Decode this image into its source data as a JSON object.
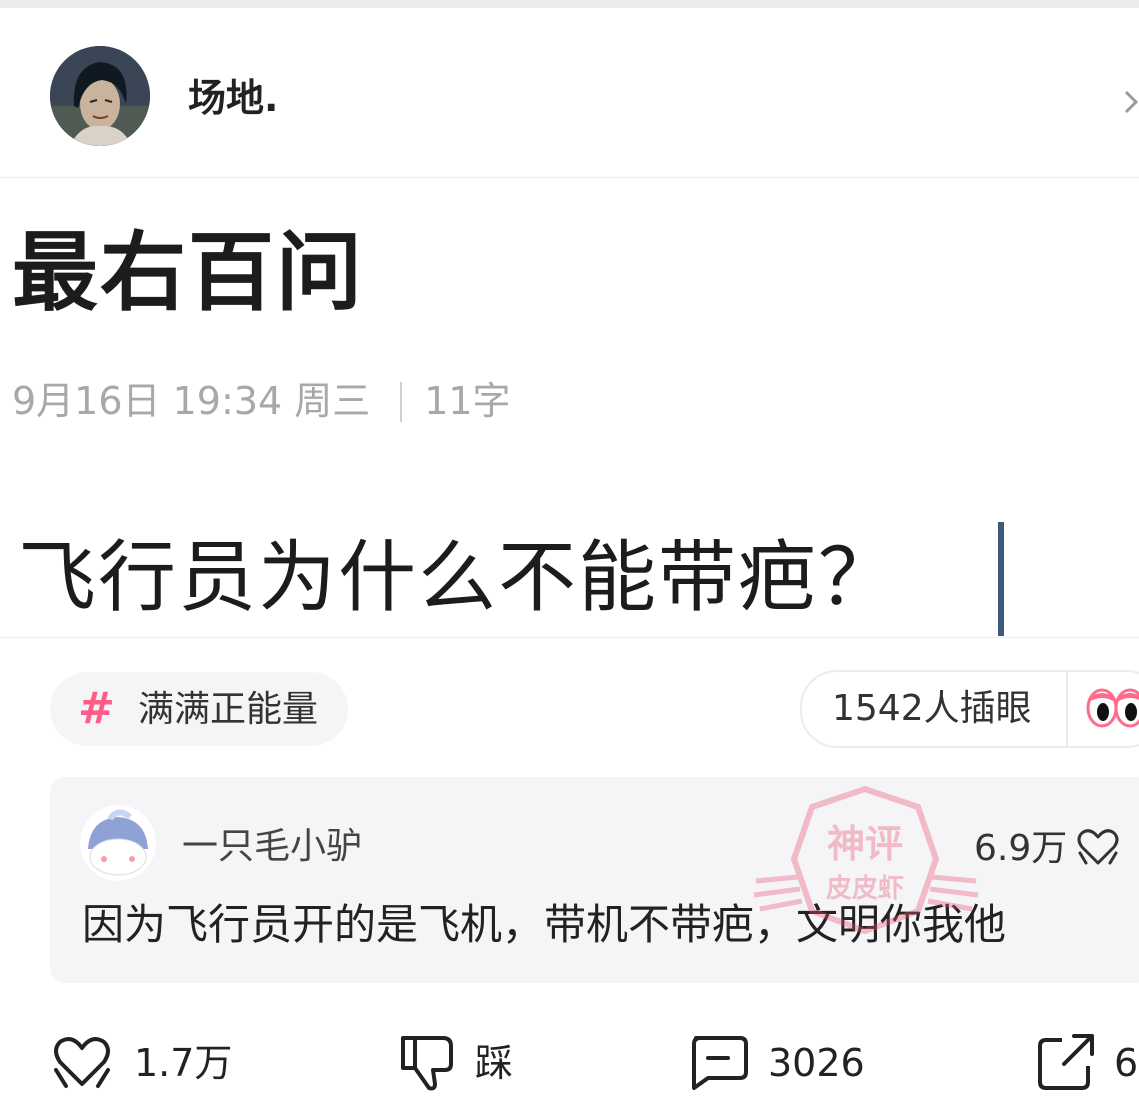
{
  "header": {
    "username": "场地."
  },
  "note": {
    "title": "最右百问",
    "date": "9月16日 19:34 周三",
    "word_count": "11字",
    "body": "飞行员为什么不能带疤？"
  },
  "tags": {
    "topic": "满满正能量",
    "topic_symbol": "#",
    "poke_label": "1542人插眼"
  },
  "comment": {
    "author": "一只毛小驴",
    "likes": "6.9万",
    "text": "因为飞行员开的是飞机，带机不带疤，文明你我他"
  },
  "watermark": {
    "line1": "神评",
    "line2": "皮皮虾"
  },
  "actions": {
    "like_count": "1.7万",
    "dislike_label": "踩",
    "comment_count": "3026",
    "share_count": "6"
  },
  "colors": {
    "accent_pink": "#ff5d86",
    "caret": "#3d5a7a",
    "meta_gray": "#a8a8a8"
  }
}
